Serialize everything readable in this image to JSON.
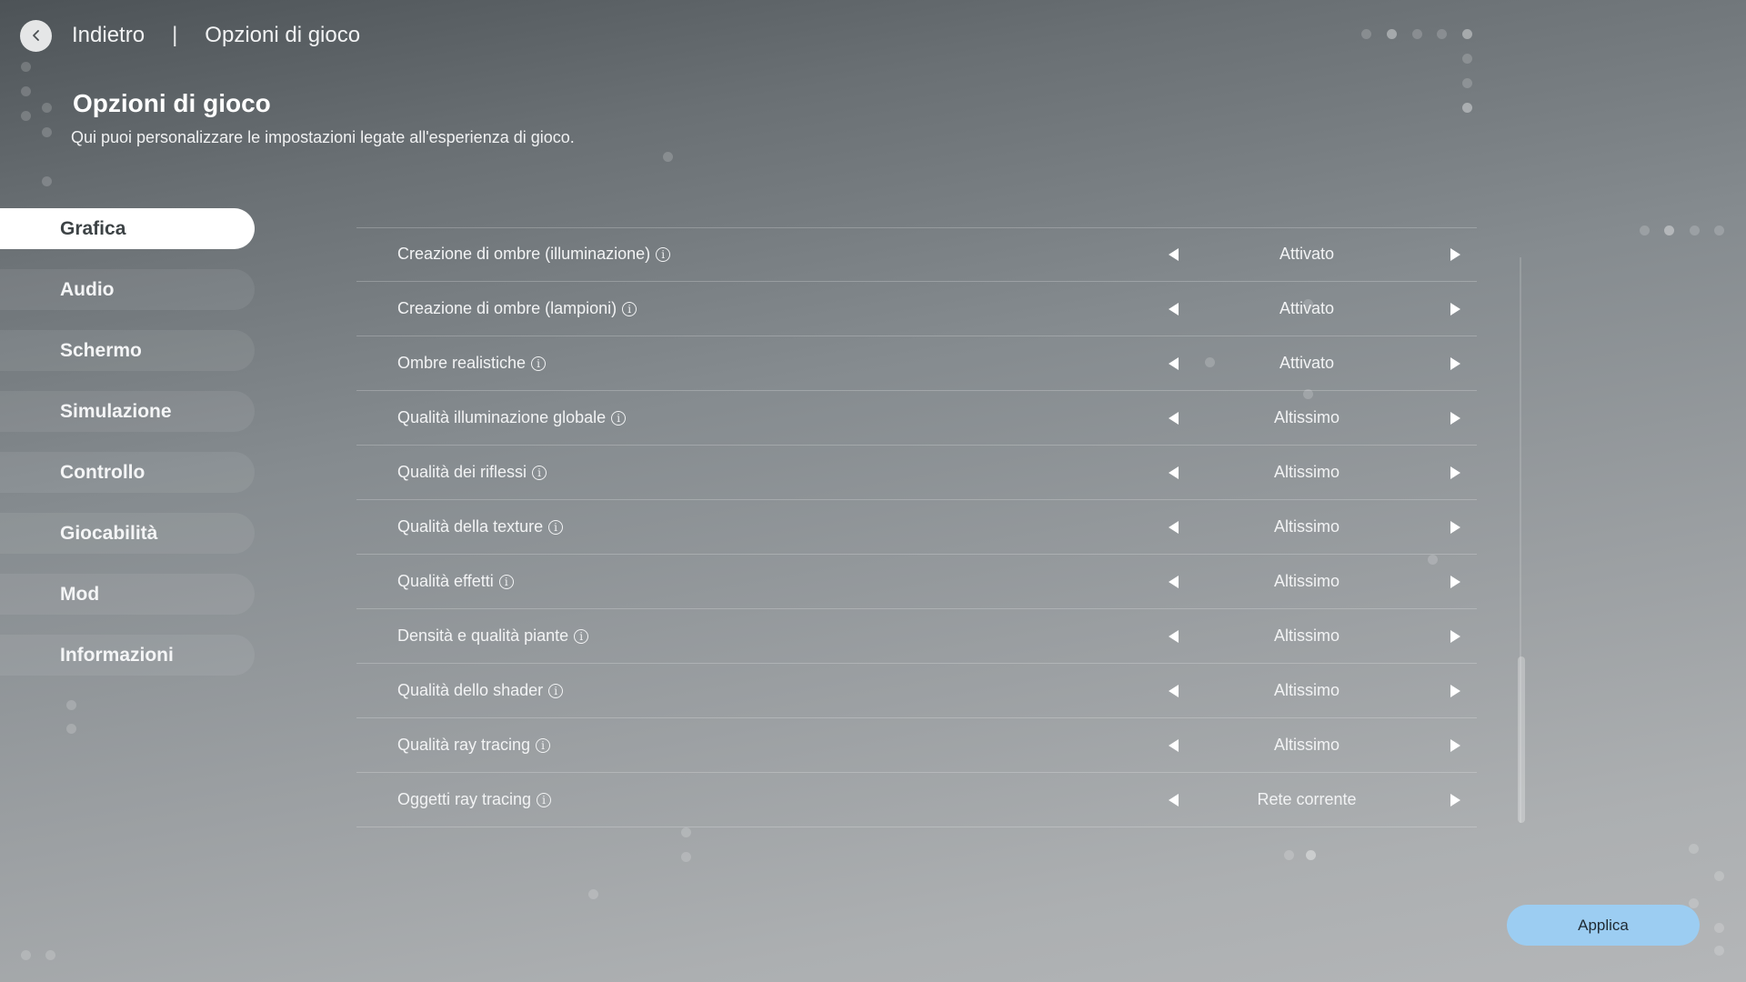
{
  "header": {
    "back_label": "Indietro",
    "separator": "|",
    "breadcrumb": "Opzioni di gioco"
  },
  "page": {
    "title": "Opzioni di gioco",
    "subtitle": "Qui puoi personalizzare le impostazioni legate all'esperienza di gioco."
  },
  "sidebar": {
    "items": [
      {
        "label": "Grafica",
        "active": true
      },
      {
        "label": "Audio",
        "active": false
      },
      {
        "label": "Schermo",
        "active": false
      },
      {
        "label": "Simulazione",
        "active": false
      },
      {
        "label": "Controllo",
        "active": false
      },
      {
        "label": "Giocabilità",
        "active": false
      },
      {
        "label": "Mod",
        "active": false
      },
      {
        "label": "Informazioni",
        "active": false
      }
    ]
  },
  "settings": [
    {
      "name": "Creazione di ombre (illuminazione)",
      "value": "Attivato"
    },
    {
      "name": "Creazione di ombre (lampioni)",
      "value": "Attivato"
    },
    {
      "name": "Ombre realistiche",
      "value": "Attivato"
    },
    {
      "name": "Qualità illuminazione globale",
      "value": "Altissimo"
    },
    {
      "name": "Qualità dei riflessi",
      "value": "Altissimo"
    },
    {
      "name": "Qualità della texture",
      "value": "Altissimo"
    },
    {
      "name": "Qualità effetti",
      "value": "Altissimo"
    },
    {
      "name": "Densità e qualità piante",
      "value": "Altissimo"
    },
    {
      "name": "Qualità dello shader",
      "value": "Altissimo"
    },
    {
      "name": "Qualità ray tracing",
      "value": "Altissimo"
    },
    {
      "name": "Oggetti ray tracing",
      "value": "Rete corrente"
    }
  ],
  "icons": {
    "back": "chevron-left-icon",
    "info": "info-icon",
    "prev": "triangle-left-icon",
    "next": "triangle-right-icon"
  },
  "footer": {
    "apply_label": "Applica"
  },
  "colors": {
    "apply_button": "#9ccdf2",
    "active_tab": "#ffffff"
  }
}
